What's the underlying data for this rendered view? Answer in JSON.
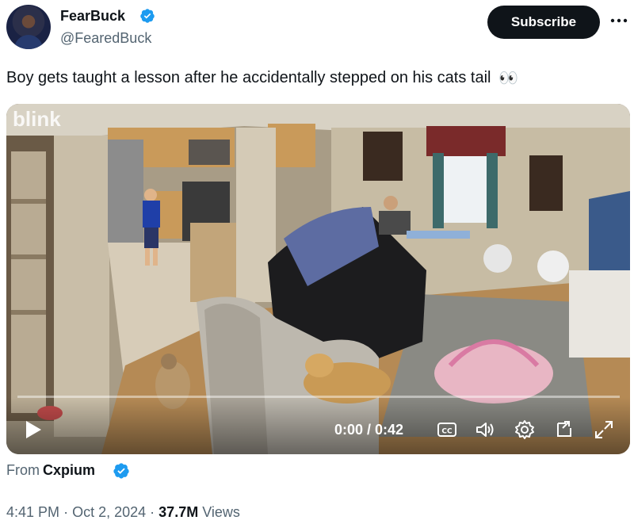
{
  "author": {
    "display_name": "FearBuck",
    "handle": "@FearedBuck",
    "verified_icon": "verified-badge-icon"
  },
  "actions": {
    "subscribe_label": "Subscribe",
    "more_icon": "more-options-icon"
  },
  "tweet": {
    "text": "Boy gets taught a lesson after he accidentally stepped on his cats tail",
    "emoji": "👀"
  },
  "video": {
    "watermark": "blink",
    "time_display": "0:00 / 0:42",
    "progress_fraction": 0,
    "controls": [
      "play-icon",
      "cc-icon",
      "volume-icon",
      "settings-icon",
      "popout-icon",
      "fullscreen-icon"
    ]
  },
  "source": {
    "prefix": "From",
    "name": "Cxpium"
  },
  "meta": {
    "time": "4:41 PM",
    "sep1": "·",
    "date": "Oct 2, 2024",
    "sep2": "·",
    "views_count": "37.7M",
    "views_label": "Views"
  },
  "colors": {
    "accent": "#1d9bf0",
    "text": "#0f1419",
    "secondary_text": "#536471"
  }
}
